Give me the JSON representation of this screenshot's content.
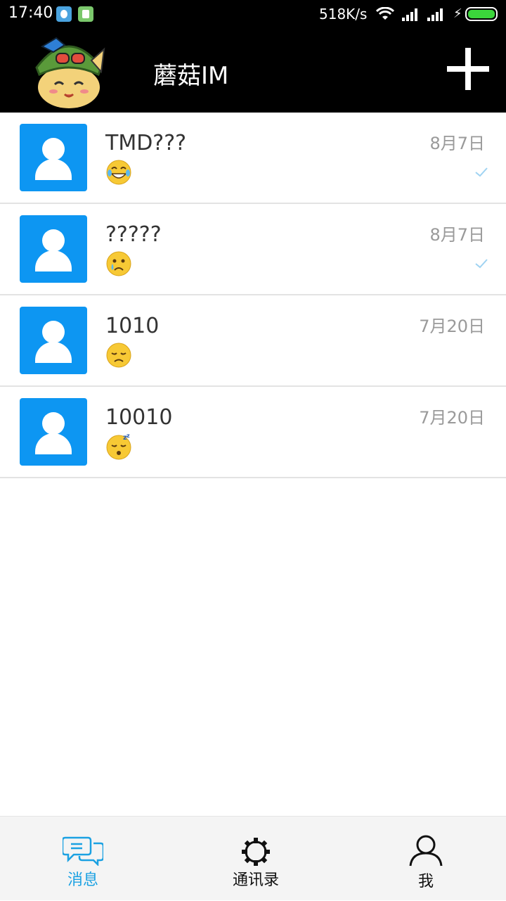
{
  "status_bar": {
    "time": "17:40",
    "network_speed": "518K/s",
    "icons": [
      "upload-icon",
      "clipboard-icon",
      "wifi-icon",
      "signal-icon",
      "signal-icon",
      "charging-icon",
      "battery-icon"
    ]
  },
  "app_bar": {
    "title": "蘑菇IM",
    "logo_icon": "teemo-logo",
    "add_icon": "plus-icon"
  },
  "conversations": [
    {
      "name": "TMD???",
      "emoji": "joy-emoji",
      "date": "8月7日",
      "read": true
    },
    {
      "name": "?????",
      "emoji": "cry-emoji",
      "date": "8月7日",
      "read": true
    },
    {
      "name": "1010",
      "emoji": "disappointed-emoji",
      "date": "7月20日",
      "read": false
    },
    {
      "name": "10010",
      "emoji": "sleeping-emoji",
      "date": "7月20日",
      "read": false
    }
  ],
  "bottom_nav": {
    "items": [
      {
        "label": "消息",
        "icon": "chat-bubbles-icon",
        "active": true
      },
      {
        "label": "通讯录",
        "icon": "gear-icon",
        "active": false
      },
      {
        "label": "我",
        "icon": "person-icon",
        "active": false
      }
    ]
  },
  "colors": {
    "accent": "#1ba1e2",
    "avatar_bg": "#0d96f2",
    "app_bar": "#000000",
    "emoji": "#f7c935"
  }
}
